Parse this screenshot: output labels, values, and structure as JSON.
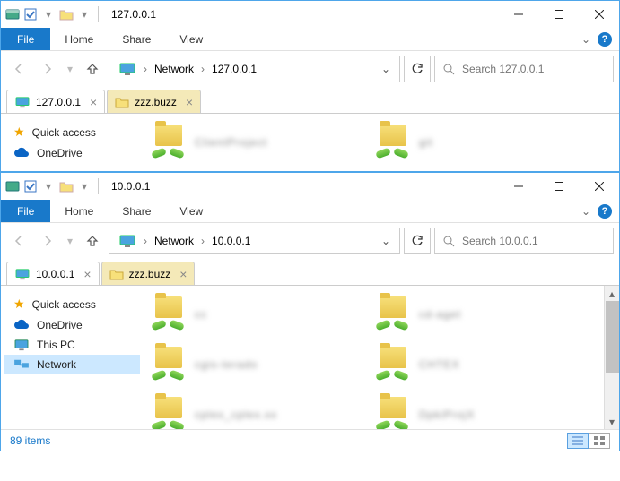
{
  "windows": [
    {
      "title": "127.0.0.1",
      "ribbon": {
        "file": "File",
        "tabs": [
          "Home",
          "Share",
          "View"
        ]
      },
      "breadcrumbs": [
        "Network",
        "127.0.0.1"
      ],
      "search_placeholder": "Search 127.0.0.1",
      "doc_tabs": [
        {
          "label": "127.0.0.1",
          "active": true,
          "kind": "computer"
        },
        {
          "label": "zzz.buzz",
          "active": false,
          "kind": "folder"
        }
      ],
      "sidebar": [
        {
          "label": "Quick access",
          "icon": "star"
        },
        {
          "label": "OneDrive",
          "icon": "cloud"
        }
      ],
      "folders": [
        {
          "label": "ClientProject"
        },
        {
          "label": "git"
        }
      ]
    },
    {
      "title": "10.0.0.1",
      "ribbon": {
        "file": "File",
        "tabs": [
          "Home",
          "Share",
          "View"
        ]
      },
      "breadcrumbs": [
        "Network",
        "10.0.0.1"
      ],
      "search_placeholder": "Search 10.0.0.1",
      "doc_tabs": [
        {
          "label": "10.0.0.1",
          "active": true,
          "kind": "computer"
        },
        {
          "label": "zzz.buzz",
          "active": false,
          "kind": "folder"
        }
      ],
      "sidebar": [
        {
          "label": "Quick access",
          "icon": "star"
        },
        {
          "label": "OneDrive",
          "icon": "cloud"
        },
        {
          "label": "This PC",
          "icon": "pc"
        },
        {
          "label": "Network",
          "icon": "network",
          "selected": true
        }
      ],
      "folders": [
        {
          "label": "cc"
        },
        {
          "label": "cd-aget"
        },
        {
          "label": "cgis-terado"
        },
        {
          "label": "CHTEX"
        },
        {
          "label": "cplex_cplex.xx"
        },
        {
          "label": "DpkiProjX"
        }
      ],
      "status": "89 items"
    }
  ]
}
